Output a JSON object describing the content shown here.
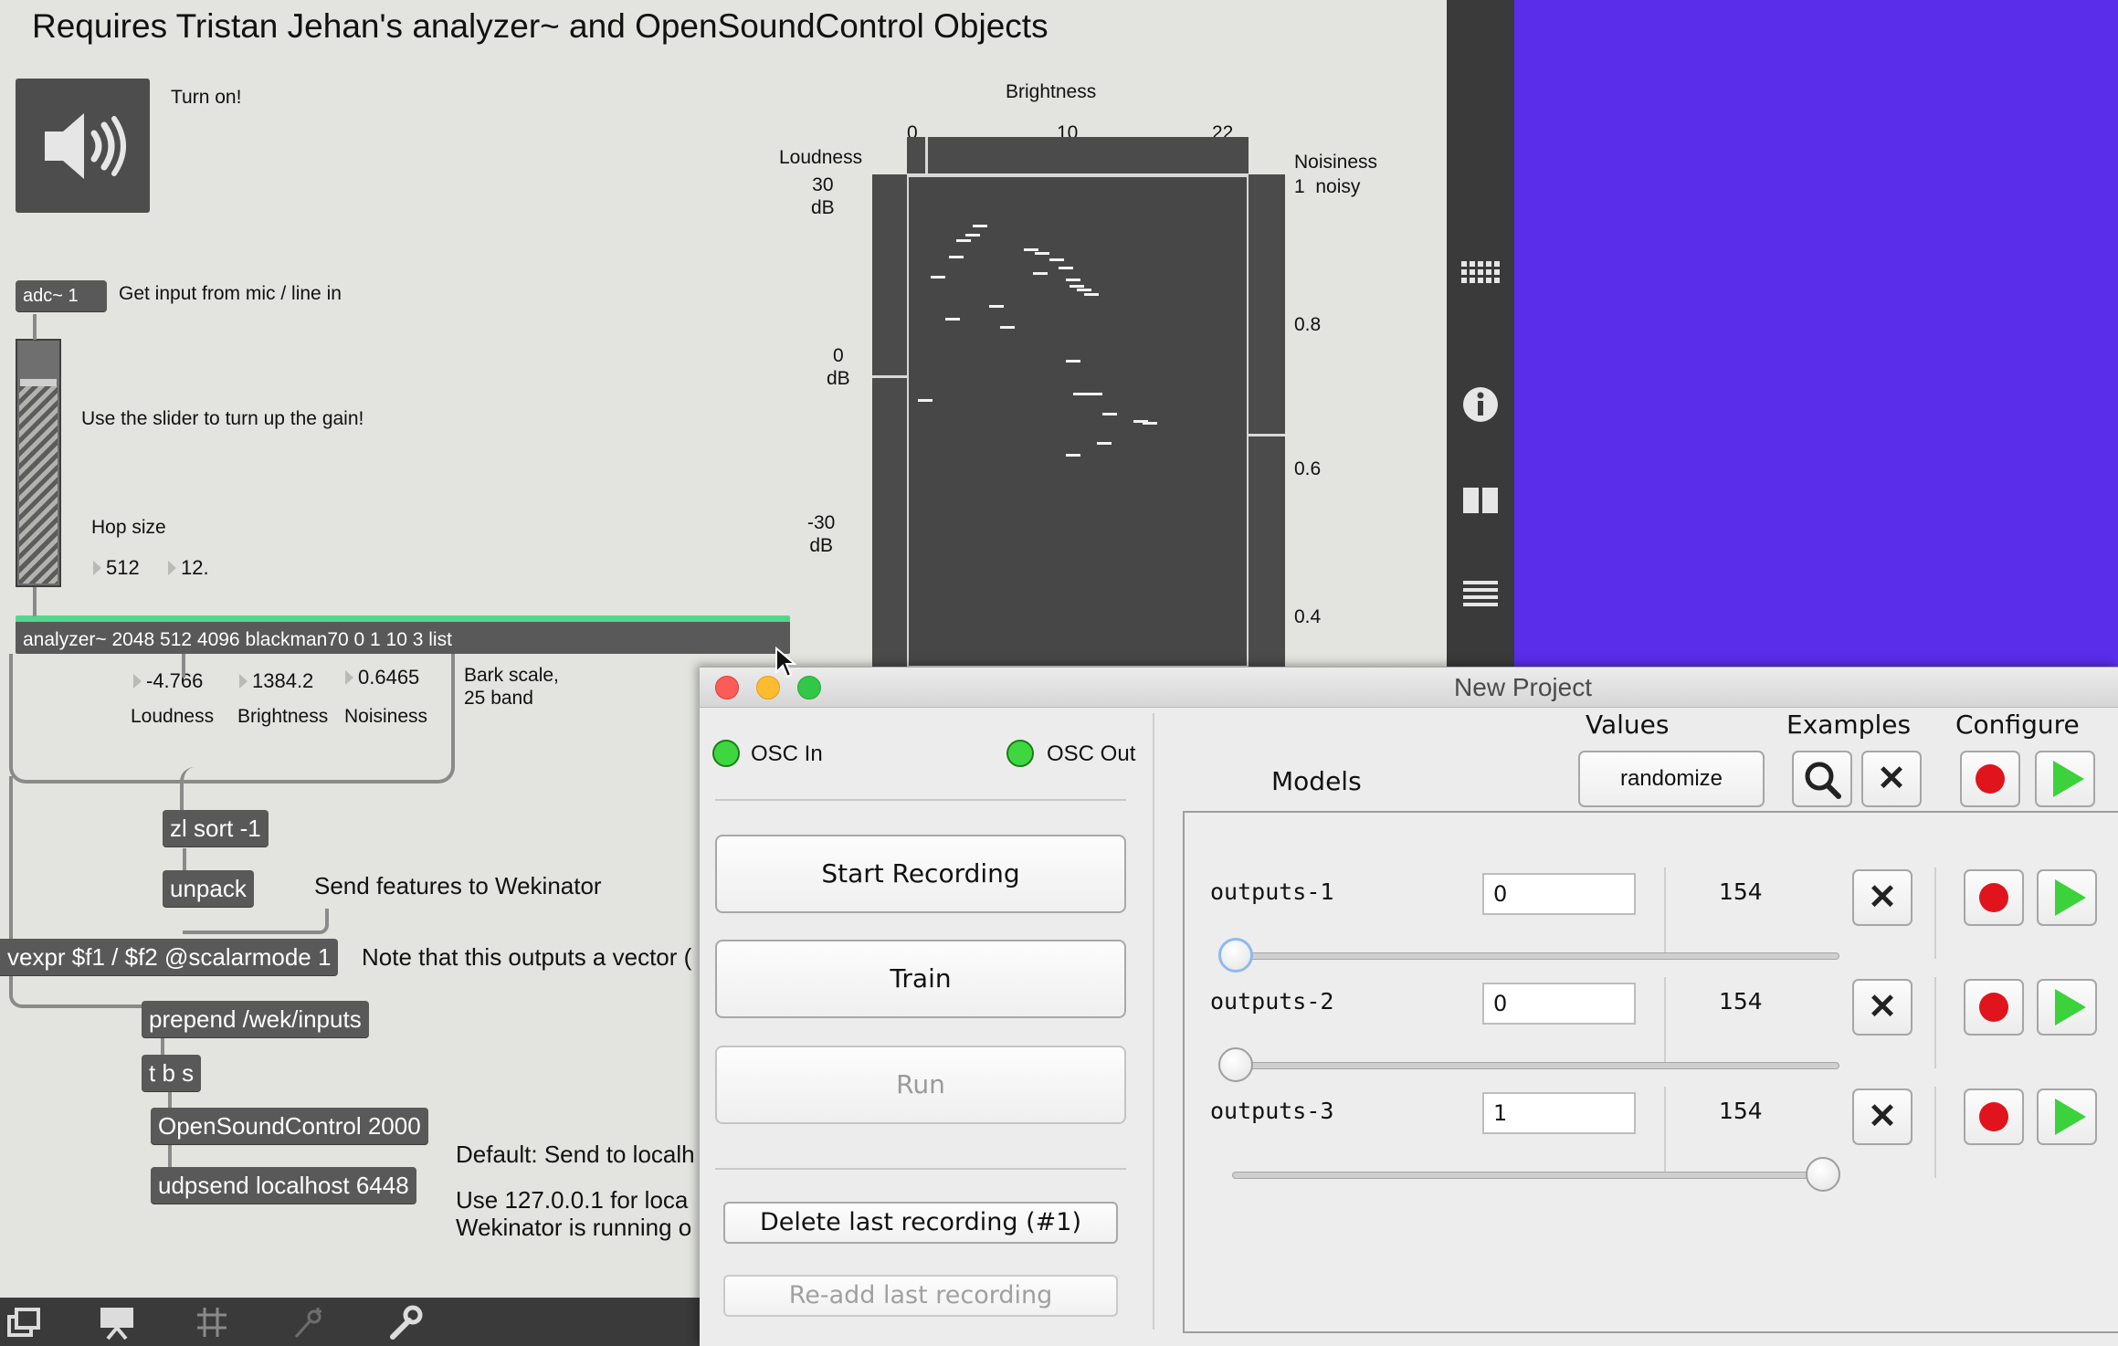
{
  "patcher": {
    "title": "Requires Tristan Jehan's analyzer~ and OpenSoundControl Objects",
    "comments": {
      "turn_on": "Turn on!",
      "get_input": "Get input from mic / line in",
      "slider_hint": "Use the slider to turn up the gain!",
      "hop_size": "Hop size",
      "bark_scale": "Bark scale,\n25 band",
      "send_features": "Send features to Wekinator",
      "vector_note": "Note that this outputs a vector (",
      "default_send": "Default: Send to localh",
      "use_localhost": "Use 127.0.0.1 for loca",
      "wekinator_running": "Wekinator is running o"
    },
    "objects": {
      "adc": "adc~ 1",
      "analyzer": "analyzer~ 2048 512 4096 blackman70 0 1 10 3 list",
      "zl_sort": "zl sort -1",
      "unpack": "unpack",
      "vexpr": "vexpr $f1 / $f2 @scalarmode 1",
      "prepend": "prepend /wek/inputs",
      "tbs": "t b s",
      "osc": "OpenSoundControl 2000",
      "udpsend": "udpsend localhost 6448"
    },
    "numbers": {
      "hop1": "512",
      "hop2": "12.",
      "loudness": "-4.766",
      "brightness": "1384.2",
      "noisiness": "0.6465"
    },
    "number_labels": {
      "loudness": "Loudness",
      "brightness": "Brightness",
      "noisiness": "Noisiness"
    },
    "display": {
      "brightness_label": "Brightness",
      "brightness_ticks": [
        "0",
        "10",
        "22"
      ],
      "loudness_label": "Loudness",
      "loudness_ticks": [
        "30\ndB",
        "0\ndB",
        "-30\ndB"
      ],
      "noisiness_label": "Noisiness",
      "noisiness_sub": "1  noisy",
      "noisiness_ticks": [
        "0.8",
        "0.6",
        "0.4"
      ]
    },
    "side_icons": [
      "grid-icon",
      "info-icon",
      "book-icon",
      "list-icon"
    ]
  },
  "wekinator": {
    "window_title": "New Project",
    "osc_in": "OSC In",
    "osc_out": "OSC Out",
    "start_recording": "Start Recording",
    "train": "Train",
    "run": "Run",
    "delete_last": "Delete last recording (#1)",
    "readd_last": "Re-add last recording",
    "headers": {
      "models": "Models",
      "values": "Values",
      "examples": "Examples",
      "configure": "Configure"
    },
    "randomize": "randomize",
    "outputs": [
      {
        "name": "outputs-1",
        "value": "0",
        "count": "154",
        "slider": 0.0
      },
      {
        "name": "outputs-2",
        "value": "0",
        "count": "154",
        "slider": 0.0
      },
      {
        "name": "outputs-3",
        "value": "1",
        "count": "154",
        "slider": 1.0
      }
    ],
    "colors": {
      "led": "#3fd73f",
      "record": "#e0141c",
      "play": "#3bd23b",
      "purple": "#5a2deb"
    }
  }
}
